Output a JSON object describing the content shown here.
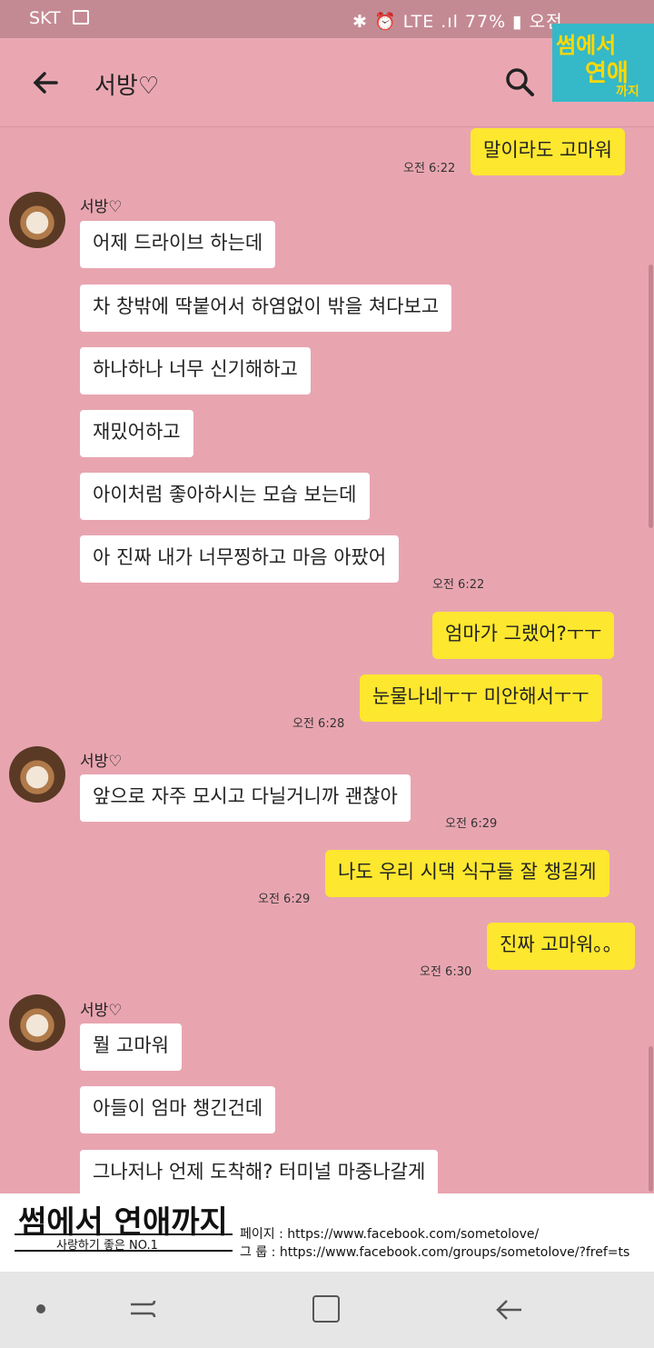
{
  "status_bar": {
    "carrier": "SKT",
    "right_text": "✱ ⏰ LTE .ıl 77% ▮ 오전"
  },
  "header": {
    "title": "서방♡"
  },
  "badge": {
    "line1": "썸에서",
    "line2": "연애",
    "line3": "까지"
  },
  "messages": [
    {
      "dir": "out",
      "text": "말이라도 고마워",
      "time": "오전 6:22"
    },
    {
      "dir": "sender",
      "name": "서방♡"
    },
    {
      "dir": "in",
      "text": "어제 드라이브 하는데"
    },
    {
      "dir": "in",
      "text": "차 창밖에 딱붙어서 하염없이 밖을 쳐다보고"
    },
    {
      "dir": "in",
      "text": "하나하나 너무 신기해하고"
    },
    {
      "dir": "in",
      "text": "재밌어하고"
    },
    {
      "dir": "in",
      "text": "아이처럼 좋아하시는 모습 보는데"
    },
    {
      "dir": "in",
      "text": "아 진짜 내가 너무찡하고 마음 아팠어",
      "time": "오전 6:22"
    },
    {
      "dir": "out",
      "text": "엄마가 그랬어?ㅜㅜ"
    },
    {
      "dir": "out",
      "text": "눈물나네ㅜㅜ 미안해서ㅜㅜ",
      "time": "오전 6:28"
    },
    {
      "dir": "sender",
      "name": "서방♡"
    },
    {
      "dir": "in",
      "text": "앞으로 자주 모시고 다닐거니까 괜찮아",
      "time": "오전 6:29"
    },
    {
      "dir": "out",
      "text": "나도 우리 시댁 식구들 잘 챙길게",
      "time": "오전 6:29"
    },
    {
      "dir": "out",
      "text": "진짜 고마워。。",
      "time": "오전 6:30"
    },
    {
      "dir": "sender",
      "name": "서방♡"
    },
    {
      "dir": "in",
      "text": "뭘 고마워"
    },
    {
      "dir": "in",
      "text": "아들이 엄마 챙긴건데"
    },
    {
      "dir": "in",
      "text": "그나저나 언제 도착해? 터미널 마중나갈게"
    }
  ],
  "footer": {
    "title": "썸에서 연애까지",
    "subtitle": "사랑하기 좋은 NO.1",
    "page_link": "페이지 : https://www.facebook.com/sometolove/",
    "group_link": "그   룹 : https://www.facebook.com/groups/sometolove/?fref=ts"
  },
  "colors": {
    "background": "#e8a5b0",
    "outgoing": "#fde72f",
    "incoming": "#ffffff"
  }
}
